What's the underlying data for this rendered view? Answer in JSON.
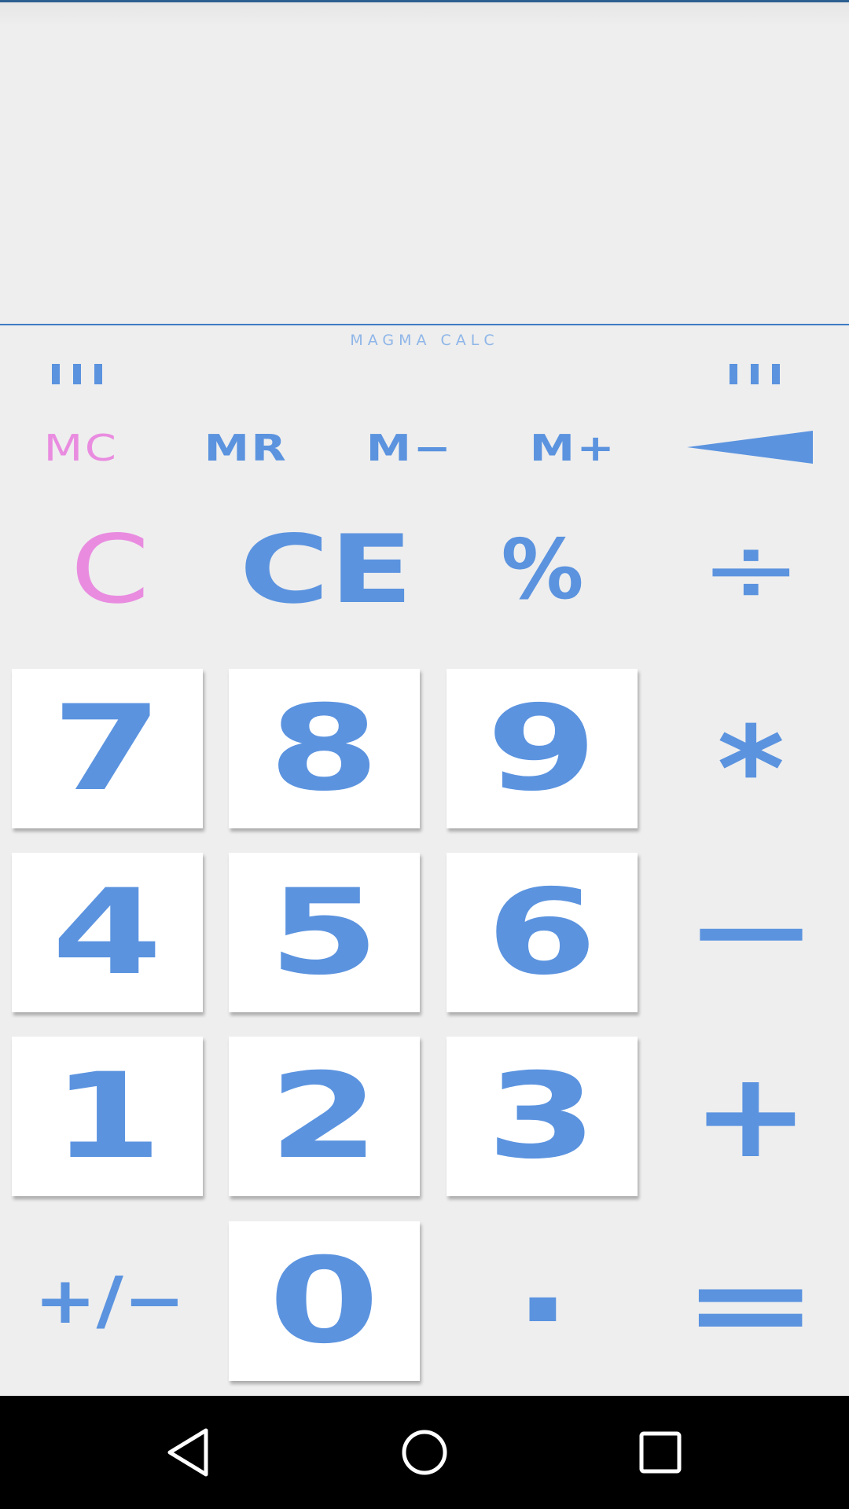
{
  "app": {
    "brand": "MAGMA CALC",
    "display_value": ""
  },
  "memory": {
    "mc": "MC",
    "mr": "MR",
    "m_minus": "M−",
    "m_plus": "M+"
  },
  "functions": {
    "clear": "C",
    "clear_entry": "CE",
    "percent": "%",
    "divide": "÷"
  },
  "keys": {
    "seven": "7",
    "eight": "8",
    "nine": "9",
    "multiply": "*",
    "four": "4",
    "five": "5",
    "six": "6",
    "minus": "−",
    "one": "1",
    "two": "2",
    "three": "3",
    "plus": "+",
    "plus_minus": "+/−",
    "zero": "0",
    "decimal": ".",
    "equals": "="
  },
  "colors": {
    "accent": "#5b93df",
    "memory_clear": "#e98ce0",
    "brand_text": "#8fb6e8",
    "background": "#eeeeee",
    "key_background": "#ffffff",
    "nav_bar": "#000000"
  },
  "icons": {
    "left_ticks": "tick-marks-icon",
    "right_ticks": "tick-marks-icon",
    "backspace": "backspace-wedge-icon",
    "nav_back": "back-triangle-icon",
    "nav_home": "home-circle-icon",
    "nav_recents": "recents-square-icon"
  }
}
